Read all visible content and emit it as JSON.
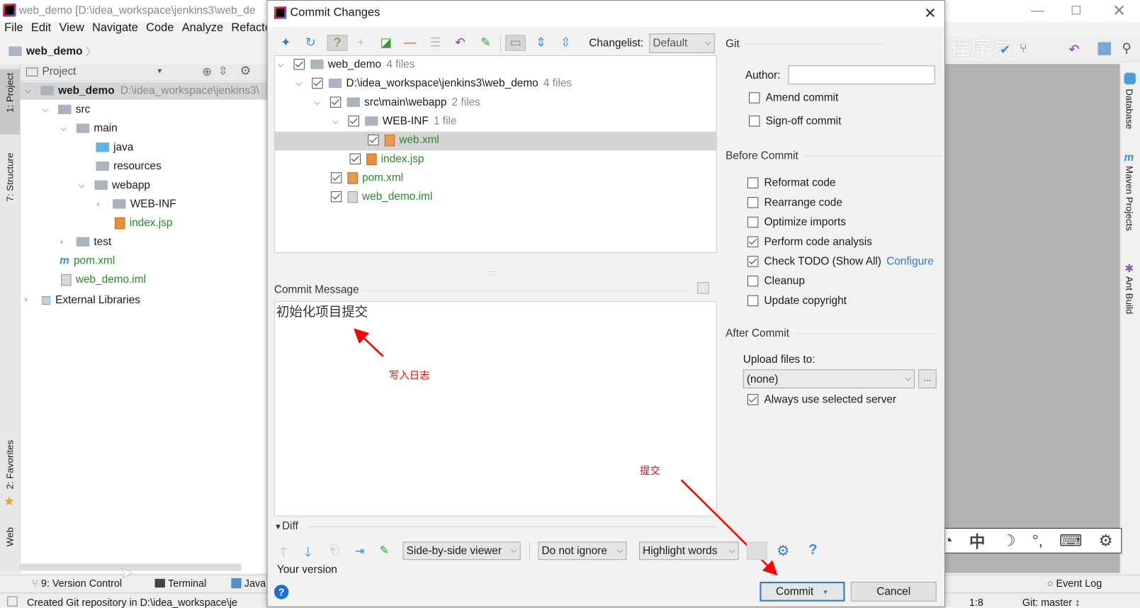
{
  "ide": {
    "title": "web_demo [D:\\idea_workspace\\jenkins3\\web_de",
    "menu": [
      "File",
      "Edit",
      "View",
      "Navigate",
      "Code",
      "Analyze",
      "Refacto"
    ],
    "breadcrumb": "web_demo",
    "project_panel_title": "Project",
    "tree": [
      {
        "label": "web_demo",
        "hint": "D:\\idea_workspace\\jenkins3\\"
      },
      {
        "label": "src"
      },
      {
        "label": "main"
      },
      {
        "label": "java"
      },
      {
        "label": "resources"
      },
      {
        "label": "webapp"
      },
      {
        "label": "WEB-INF"
      },
      {
        "label": "index.jsp"
      },
      {
        "label": "test"
      },
      {
        "label": "pom.xml"
      },
      {
        "label": "web_demo.iml"
      },
      {
        "label": "External Libraries"
      }
    ],
    "left_tabs": [
      "1: Project",
      "7: Structure",
      "2: Favorites",
      "Web"
    ],
    "right_tabs": [
      "Database",
      "Maven Projects",
      "Ant Build"
    ],
    "bottom_tabs": [
      "9: Version Control",
      "Terminal",
      "Java",
      "Event Log"
    ],
    "status_message": "Created Git repository in D:\\idea_workspace\\je",
    "cursor_pos": "1:8",
    "branch": "Git: master ↕",
    "watermark": "黑马程序员"
  },
  "dialog": {
    "title": "Commit Changes",
    "changelist_label": "Changelist:",
    "changelist_value": "Default",
    "tree": [
      {
        "label": "web_demo",
        "count": "4 files",
        "checked": true
      },
      {
        "label": "D:\\idea_workspace\\jenkins3\\web_demo",
        "count": "4 files",
        "checked": true
      },
      {
        "label": "src\\main\\webapp",
        "count": "2 files",
        "checked": true
      },
      {
        "label": "WEB-INF",
        "count": "1 file",
        "checked": true
      },
      {
        "label": "web.xml",
        "checked": true
      },
      {
        "label": "index.jsp",
        "checked": true
      },
      {
        "label": "pom.xml",
        "checked": true
      },
      {
        "label": "web_demo.iml",
        "checked": true
      }
    ],
    "commit_message_label": "Commit Message",
    "commit_message": "初始化项目提交",
    "git_section": "Git",
    "author_label": "Author:",
    "author_value": "",
    "amend": {
      "label": "Amend commit",
      "checked": false
    },
    "signoff": {
      "label": "Sign-off commit",
      "checked": false
    },
    "before_commit_section": "Before Commit",
    "before_commit": [
      {
        "label": "Reformat code",
        "checked": false
      },
      {
        "label": "Rearrange code",
        "checked": false
      },
      {
        "label": "Optimize imports",
        "checked": false
      },
      {
        "label": "Perform code analysis",
        "checked": true
      },
      {
        "label": "Check TODO (Show All)",
        "checked": true
      },
      {
        "label": "Cleanup",
        "checked": false
      },
      {
        "label": "Update copyright",
        "checked": false
      }
    ],
    "configure_link": "Configure",
    "after_commit_section": "After Commit",
    "upload_label": "Upload files to:",
    "upload_value": "(none)",
    "browse_label": "...",
    "always_use": {
      "label": "Always use selected server",
      "checked": true
    },
    "diff_label": "Diff",
    "viewer": "Side-by-side viewer",
    "ignore": "Do not ignore",
    "highlight": "Highlight words",
    "help": "?",
    "your_version": "Your version",
    "commit_button": "Commit",
    "cancel_button": "Cancel"
  },
  "annotations": {
    "log_note": "写入日志",
    "commit_note": "提交",
    "color": "#ff0000"
  },
  "ime": {
    "lang": "中"
  }
}
